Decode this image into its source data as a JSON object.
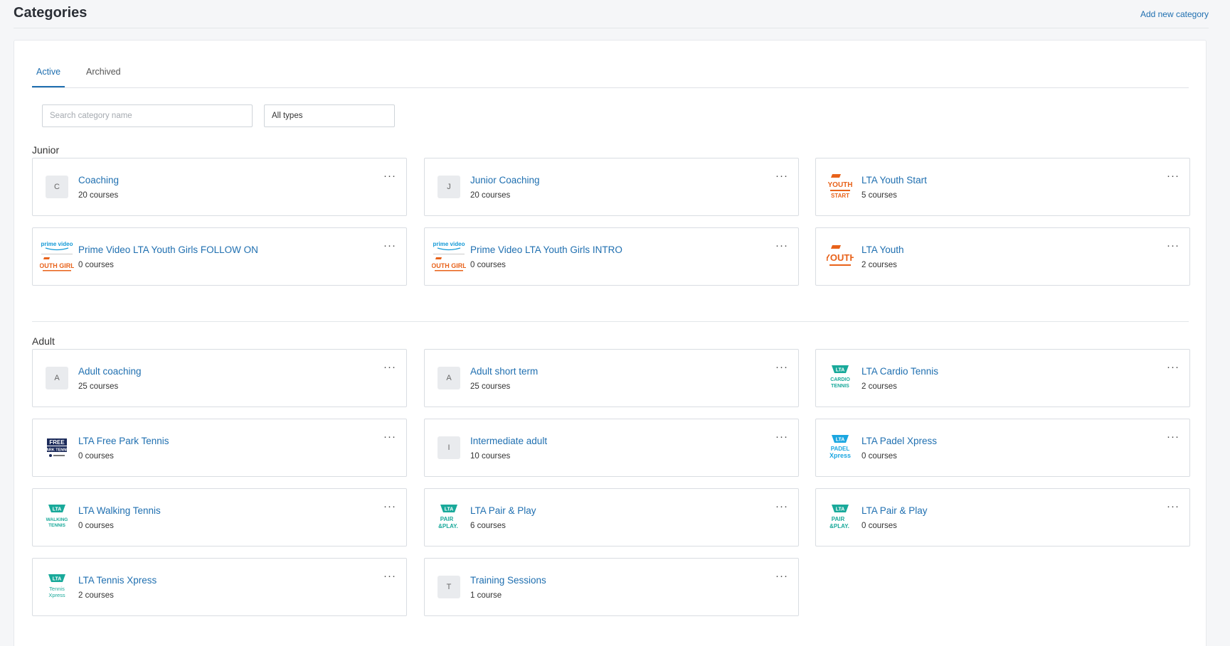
{
  "header": {
    "title": "Categories",
    "add_label": "Add new category"
  },
  "tabs": [
    {
      "label": "Active"
    },
    {
      "label": "Archived"
    }
  ],
  "filters": {
    "search_placeholder": "Search category name",
    "type_value": "All types"
  },
  "more_label": "···",
  "sections": [
    {
      "title": "Junior",
      "cards": [
        {
          "name": "Coaching",
          "count": "20 courses",
          "logo": "letter",
          "letter": "C"
        },
        {
          "name": "Junior Coaching",
          "count": "20 courses",
          "logo": "letter",
          "letter": "J"
        },
        {
          "name": "LTA Youth Start",
          "count": "5 courses",
          "logo": "youth-start-logo"
        },
        {
          "name": "Prime Video LTA Youth Girls FOLLOW ON",
          "count": "0 courses",
          "logo": "prime-youth-girls-logo"
        },
        {
          "name": "Prime Video LTA Youth Girls INTRO",
          "count": "0 courses",
          "logo": "prime-youth-girls-logo"
        },
        {
          "name": "LTA Youth",
          "count": "2 courses",
          "logo": "youth-logo"
        }
      ]
    },
    {
      "title": "Adult",
      "cards": [
        {
          "name": "Adult coaching",
          "count": "25 courses",
          "logo": "letter",
          "letter": "A"
        },
        {
          "name": "Adult short term",
          "count": "25 courses",
          "logo": "letter",
          "letter": "A"
        },
        {
          "name": "LTA Cardio Tennis",
          "count": "2 courses",
          "logo": "cardio-tennis-logo"
        },
        {
          "name": "LTA Free Park Tennis",
          "count": "0 courses",
          "logo": "free-park-tennis-logo"
        },
        {
          "name": "Intermediate adult",
          "count": "10 courses",
          "logo": "letter",
          "letter": "I"
        },
        {
          "name": "LTA Padel Xpress",
          "count": "0 courses",
          "logo": "padel-xpress-logo"
        },
        {
          "name": "LTA Walking Tennis",
          "count": "0 courses",
          "logo": "walking-tennis-logo"
        },
        {
          "name": "LTA Pair & Play",
          "count": "6 courses",
          "logo": "pair-play-logo"
        },
        {
          "name": "LTA Pair & Play",
          "count": "0 courses",
          "logo": "pair-play-logo"
        },
        {
          "name": "LTA Tennis Xpress",
          "count": "2 courses",
          "logo": "tennis-xpress-logo"
        },
        {
          "name": "Training Sessions",
          "count": "1 course",
          "logo": "letter",
          "letter": "T"
        }
      ]
    }
  ]
}
